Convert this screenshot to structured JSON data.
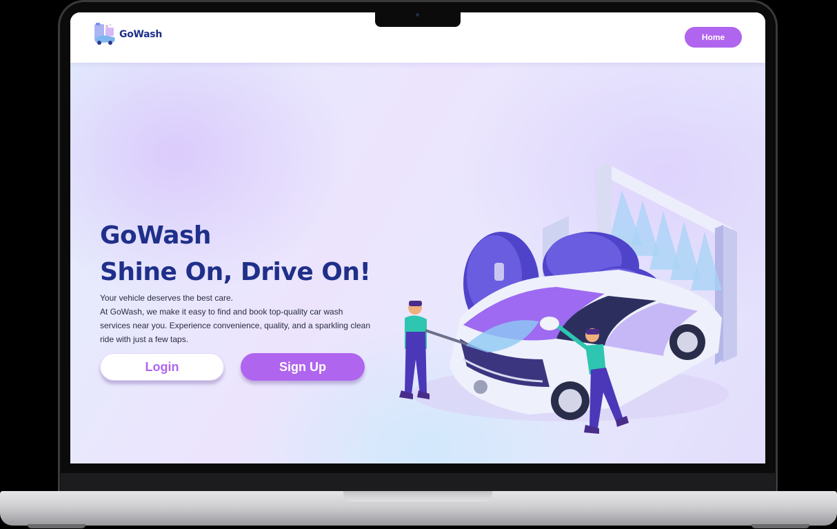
{
  "brand": {
    "name": "GoWash",
    "accent_color": "#b065ee",
    "title_color": "#1f2f8a"
  },
  "nav": {
    "home_label": "Home"
  },
  "hero": {
    "title_line1": "GoWash",
    "title_line2": "Shine On, Drive On!",
    "desc_line1": "Your vehicle deserves the best care.",
    "desc_line2": "At GoWash, we make it easy to find and book top-quality car wash services near you. Experience convenience, quality, and a sparkling clean ride with just a few taps.",
    "login_label": "Login",
    "signup_label": "Sign Up",
    "illustration_icon": "car-wash-illustration"
  }
}
